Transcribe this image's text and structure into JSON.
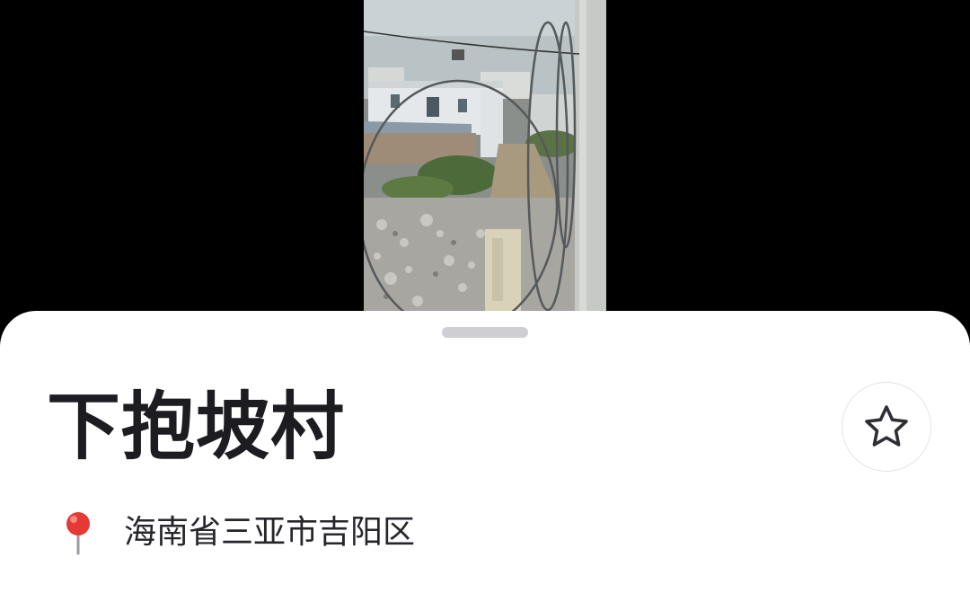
{
  "media": {
    "description_icon": "video-frame"
  },
  "place": {
    "name": "下抱坡村",
    "address": "海南省三亚市吉阳区",
    "favorite_icon": "star-outline-icon",
    "location_icon": "red-map-pin-icon"
  },
  "colors": {
    "sheet_background": "#ffffff",
    "title_text": "#1c1c21",
    "star_stroke": "#2e2e35",
    "pin_red": "#e53935"
  }
}
